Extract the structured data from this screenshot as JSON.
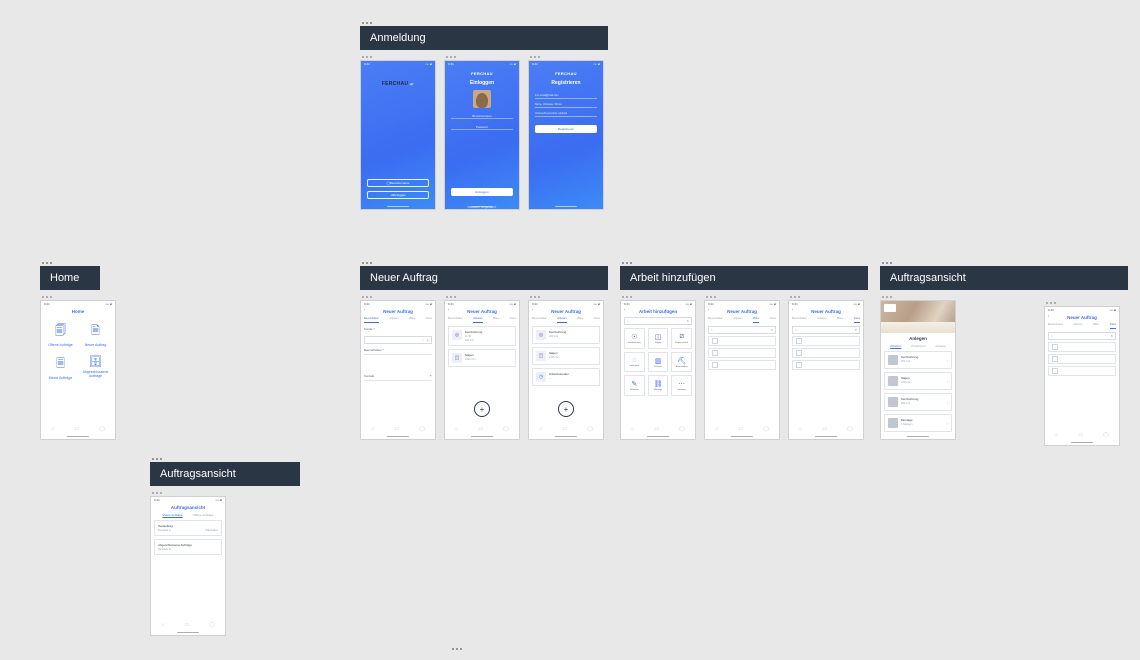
{
  "sections": {
    "anmeldung": {
      "title": "Anmeldung"
    },
    "home": {
      "title": "Home"
    },
    "neuer_auftrag": {
      "title": "Neuer Auftrag"
    },
    "arbeit": {
      "title": "Arbeit hinzufügen"
    },
    "auftragsansicht1": {
      "title": "Auftragsansicht"
    },
    "auftragsansicht2": {
      "title": "Auftragsansicht"
    }
  },
  "status": {
    "time": "9:41"
  },
  "brand": {
    "name": "FERCHAU",
    "small": "FERCHAU"
  },
  "login": {
    "welcome_label": "Benutzername",
    "login_btn": "Einloggen",
    "register_btn": "Registrieren",
    "title_login": "Einloggen",
    "username_label": "Benutzername",
    "password_label": "Passwort",
    "forgot": "Passwort vergessen?",
    "submit": "Einloggen",
    "title_register": "Registrieren",
    "reg_email": "ihre-email@mail.com",
    "reg_name": "Name, Vorname / Firma",
    "reg_company": "Unternehmensname optional",
    "reg_submit": "Registrieren"
  },
  "home": {
    "title": "Home",
    "items": [
      {
        "label": "Offene Aufträge"
      },
      {
        "label": "Neuer Auftrag"
      },
      {
        "label": "Meine Aufträge"
      },
      {
        "label": "Abgeschlossene Aufträge"
      }
    ]
  },
  "neuer_auftrag": {
    "title": "Neuer Auftrag",
    "tabs": [
      "Bauvorhaben",
      "Arbeiten",
      "Pläne",
      "Fotos"
    ],
    "kunde_label": "Kunde *",
    "bauvorhaben_label": "Bauvorhaben *",
    "kontakt_label": "Kontakt",
    "cards": {
      "kernbohrung": {
        "title": "Kernbohrung",
        "sub1": "11:30",
        "sub2": "200 mm"
      },
      "sagen": {
        "title": "Sägen",
        "sub1": "1200 mm"
      },
      "arbeit": {
        "title": "Arbeit hinzufügen"
      },
      "arbeitsstunden": {
        "title": "Arbeitsstunden"
      }
    }
  },
  "arbeit": {
    "title": "Arbeit hinzufügen",
    "grid": [
      "Kernbohrung",
      "Sägen",
      "Fugenschnitt",
      "Seilsägen",
      "Pressen",
      "Betonabbau",
      "Schleifen",
      "Montage",
      "Sonstige"
    ],
    "alt_title": "Neuer Auftrag"
  },
  "auftragsansicht": {
    "title": "Auftragsansicht",
    "sub_tabs": [
      "Arbeiten",
      "Positionen",
      "Anhang"
    ],
    "detail_title": "Anlegen",
    "cards": [
      {
        "title": "Kernbohrung",
        "sub": "200 mm"
      },
      {
        "title": "Sägen",
        "sub": "1200 mm"
      },
      {
        "title": "Kernbohrung",
        "sub": "200 mm"
      },
      {
        "title": "Montage",
        "sub": "4 Stangen"
      }
    ],
    "list_tabs": [
      "Meine Aufträge",
      "Offene Aufträge"
    ],
    "list_items": [
      {
        "title": "Testauftrag",
        "sub": "Baustelle A",
        "right": "Offenhalten"
      },
      {
        "title": "Abgeschlossene Aufträge",
        "sub": "Baustelle B",
        "right": ""
      }
    ]
  },
  "icons": {
    "search": "⌕",
    "plus": "+",
    "chevron": "›",
    "close": "✕",
    "home": "⌂",
    "list": "≡",
    "user": "◯"
  }
}
